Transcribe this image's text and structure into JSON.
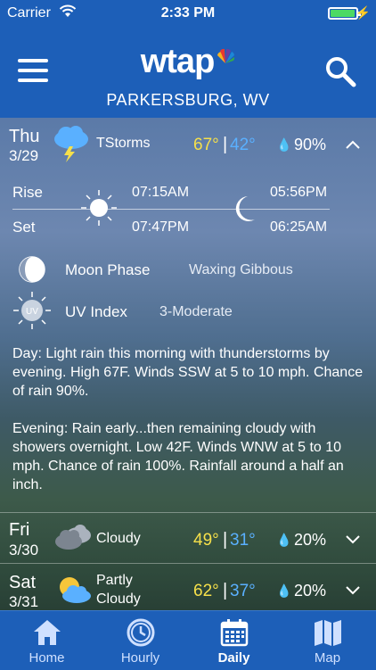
{
  "status": {
    "carrier": "Carrier",
    "time": "2:33 PM",
    "battery_level": 0.95
  },
  "header": {
    "logo": "wtap",
    "city": "PARKERSBURG, WV"
  },
  "expanded_day": {
    "day": "Thu",
    "date": "3/29",
    "condition": "TStorms",
    "high": "67°",
    "low": "42°",
    "precip": "90%",
    "rise_label": "Rise",
    "set_label": "Set",
    "sunrise": "07:15AM",
    "sunset": "07:47PM",
    "moonset": "05:56PM",
    "moonrise": "06:25AM",
    "moon_phase_label": "Moon Phase",
    "moon_phase": "Waxing Gibbous",
    "uv_icon_text": "UV",
    "uv_label": "UV Index",
    "uv_value": "3-Moderate",
    "day_label": "Day",
    "day_text": ": Light rain this morning with thunderstorms by evening. High 67F. Winds SSW at 5 to 10 mph. Chance of rain 90%.",
    "evening_label": "Evening",
    "evening_text": ": Rain early...then remaining cloudy with showers overnight. Low 42F. Winds WNW at 5 to 10 mph. Chance of rain 100%. Rainfall around a half an inch."
  },
  "days": [
    {
      "day": "Fri",
      "date": "3/30",
      "condition": "Cloudy",
      "high": "49°",
      "low": "31°",
      "precip": "20%"
    },
    {
      "day": "Sat",
      "date": "3/31",
      "condition": "Partly\nCloudy",
      "condition_line1": "Partly",
      "condition_line2": "Cloudy",
      "high": "62°",
      "low": "37°",
      "precip": "20%"
    }
  ],
  "tabs": [
    {
      "label": "Home",
      "icon": "home-icon"
    },
    {
      "label": "Hourly",
      "icon": "clock-icon"
    },
    {
      "label": "Daily",
      "icon": "calendar-icon",
      "active": true
    },
    {
      "label": "Map",
      "icon": "map-icon"
    }
  ],
  "colors": {
    "brand_blue": "#1d5fb8",
    "high_temp": "#f6e04a",
    "low_temp": "#5ab0ff",
    "battery": "#4cd964"
  }
}
